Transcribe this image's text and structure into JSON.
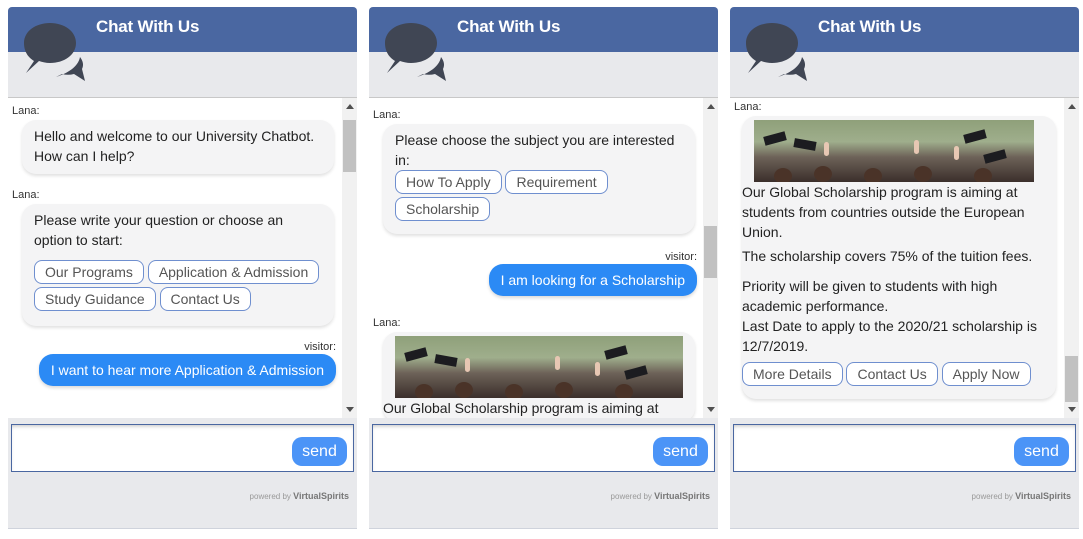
{
  "colors": {
    "header": "#4a67a1",
    "visitor_bubble": "#2b8af5",
    "send_button": "#4b94f7"
  },
  "panels": [
    {
      "title": "Chat With Us",
      "icon": "chat-bubbles-icon",
      "messages": [
        {
          "sender": "Lana:",
          "text": "Hello and welcome to our University Chatbot. How can I help?"
        },
        {
          "sender": "Lana:",
          "text": "Please write your question or choose an option to start:",
          "options": [
            "Our Programs",
            "Application & Admission",
            "Study Guidance",
            "Contact Us"
          ]
        },
        {
          "sender": "visitor:",
          "text": "I want to hear more Application & Admission"
        }
      ],
      "input": {
        "value": "",
        "placeholder": ""
      },
      "send_label": "send",
      "powered_prefix": "powered by",
      "powered_brand": "VirtualSpirits"
    },
    {
      "title": "Chat With Us",
      "icon": "chat-bubbles-icon",
      "messages": [
        {
          "sender": "Lana:",
          "text": "Please choose the subject you are interested in:",
          "options": [
            "How To Apply",
            "Requirement",
            "Scholarship"
          ]
        },
        {
          "sender": "visitor:",
          "text": "I am looking for a Scholarship"
        },
        {
          "sender": "Lana:",
          "image": "graduation-caps-photo",
          "text": "Our Global Scholarship program is aiming at"
        }
      ],
      "input": {
        "value": "",
        "placeholder": ""
      },
      "send_label": "send",
      "powered_prefix": "powered by",
      "powered_brand": "VirtualSpirits"
    },
    {
      "title": "Chat With Us",
      "icon": "chat-bubbles-icon",
      "messages": [
        {
          "sender": "Lana:",
          "image": "graduation-caps-photo",
          "paragraphs": [
            "Our Global Scholarship program is aiming at students from countries outside the European Union.",
            "The scholarship covers 75% of the tuition fees.",
            "Priority will be given to students with high academic performance.",
            "Last Date to apply to the 2020/21 scholarship is 12/7/2019."
          ],
          "options": [
            "More Details",
            "Contact Us",
            "Apply Now"
          ]
        }
      ],
      "input": {
        "value": "",
        "placeholder": ""
      },
      "send_label": "send",
      "powered_prefix": "powered by",
      "powered_brand": "VirtualSpirits"
    }
  ]
}
